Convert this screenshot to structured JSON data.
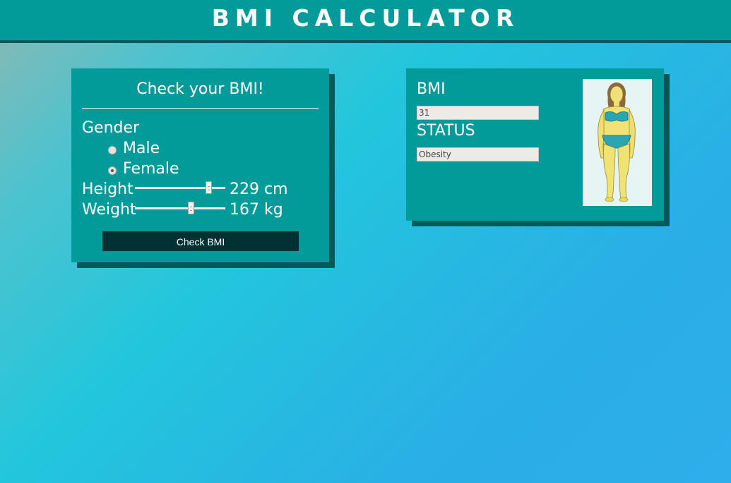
{
  "header": {
    "title": "BMI CALCULATOR"
  },
  "form": {
    "title": "Check your BMI!",
    "gender_label": "Gender",
    "gender_options": [
      {
        "label": "Male",
        "checked": false
      },
      {
        "label": "Female",
        "checked": true
      }
    ],
    "height_label": "Height",
    "height_value": "229 cm",
    "height_slider_fraction": 0.84,
    "weight_label": "Weight",
    "weight_value": "167 kg",
    "weight_slider_fraction": 0.63,
    "check_button_label": "Check BMI"
  },
  "result": {
    "bmi_label": "BMI",
    "bmi_value": "31",
    "status_label": "STATUS",
    "status_value": "Obesity",
    "figure_icon": "obese-female-figure-icon"
  },
  "colors": {
    "header_bg": "#039a9a",
    "card_bg": "#039a9a",
    "card_shadow": "#03585a",
    "button_bg": "#013133"
  }
}
